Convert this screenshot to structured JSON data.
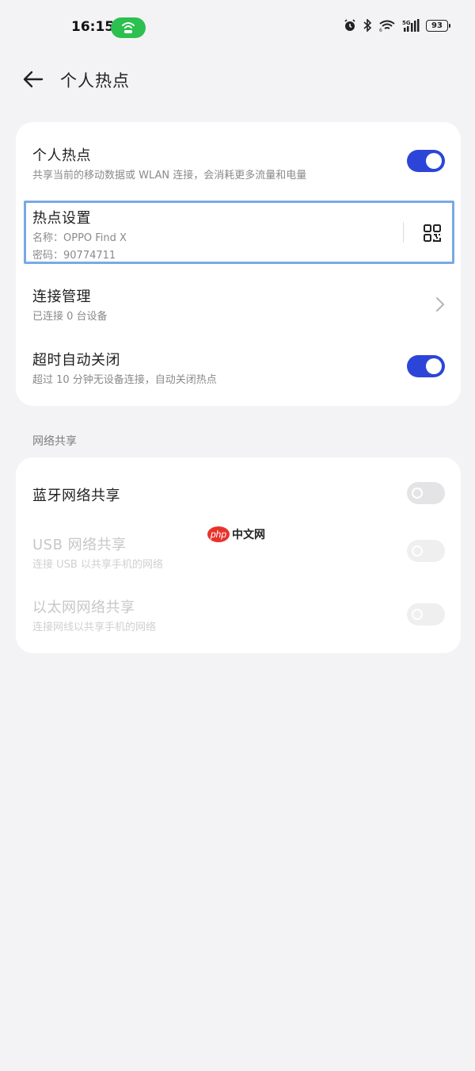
{
  "status_bar": {
    "time": "16:15",
    "battery": "93",
    "icons": [
      "hotspot-icon",
      "alarm-icon",
      "bluetooth-icon",
      "wifi-icon",
      "signal-5g-icon",
      "battery-icon"
    ],
    "hotspot_pill_color": "#2bc04f"
  },
  "header": {
    "title": "个人热点"
  },
  "hotspot_card": {
    "personal_hotspot": {
      "title": "个人热点",
      "subtitle": "共享当前的移动数据或 WLAN 连接，会消耗更多流量和电量",
      "enabled": true
    },
    "hotspot_settings": {
      "title": "热点设置",
      "name_line": "名称：OPPO Find X",
      "password_line": "密码：90774711"
    },
    "connection_management": {
      "title": "连接管理",
      "subtitle": "已连接 0 台设备"
    },
    "auto_off": {
      "title": "超时自动关闭",
      "subtitle": "超过 10 分钟无设备连接，自动关闭热点",
      "enabled": true
    }
  },
  "network_sharing": {
    "section_label": "网络共享",
    "bluetooth": {
      "title": "蓝牙网络共享",
      "enabled": false
    },
    "usb": {
      "title": "USB 网络共享",
      "subtitle": "连接 USB 以共享手机的网络",
      "enabled": false,
      "disabled": true
    },
    "ethernet": {
      "title": "以太网网络共享",
      "subtitle": "连接网线以共享手机的网络",
      "enabled": false,
      "disabled": true
    }
  },
  "watermark": {
    "logo": "php",
    "text": "中文网"
  },
  "colors": {
    "accent": "#2c45d8",
    "background": "#f3f3f5",
    "highlight": "#7aa8e6"
  }
}
